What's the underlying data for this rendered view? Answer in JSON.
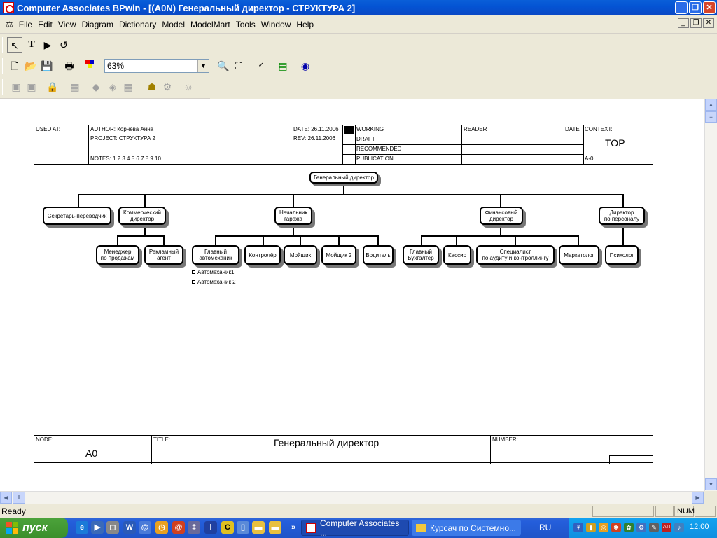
{
  "window": {
    "title": "Computer Associates BPwin - [(A0N) Генеральный директор - СТРУКТУРА 2]",
    "min_label": "_",
    "max_label": "❐",
    "close_label": "✕"
  },
  "menu": {
    "items": [
      "File",
      "Edit",
      "View",
      "Diagram",
      "Dictionary",
      "Model",
      "ModelMart",
      "Tools",
      "Window",
      "Help"
    ]
  },
  "toolbar": {
    "zoom_value": "63%"
  },
  "diagram": {
    "header": {
      "used_at": "USED AT:",
      "author": "AUTHOR:  Корнева Анна",
      "project": "PROJECT:  СТРУКТУРА 2",
      "date": "DATE:  26.11.2006",
      "rev": "REV:   26.11.2006",
      "notes": "NOTES:  1  2  3  4  5  6  7  8  9  10",
      "status": [
        "WORKING",
        "DRAFT",
        "RECOMMENDED",
        "PUBLICATION"
      ],
      "reader": "READER",
      "reader_date": "DATE",
      "context": "CONTEXT:",
      "context_value": "TOP",
      "context_node": "A-0"
    },
    "footer": {
      "node_label": "NODE:",
      "node_value": "A0",
      "title_label": "TITLE:",
      "title_value": "Генеральный директор",
      "number_label": "NUMBER:"
    },
    "boxes": {
      "gen_dir": "Генеральный директор",
      "secretary": "Секретарь-переводчик",
      "commercial": "Коммерческий\nдиректор",
      "garage": "Начальник\nгаража",
      "financial": "Финансовый\nдиректор",
      "hr": "Директор\nпо персоналу",
      "sales_mgr": "Менеджер\nпо продажам",
      "ad_agent": "Рекламный\nагент",
      "chief_mech": "Главный\nавтомеханик",
      "controller": "Контролёр",
      "washer": "Мойщик",
      "washer2": "Мойщик 2",
      "driver": "Водитель",
      "chief_acc": "Главный\nБухгалтер",
      "cashier": "Кассир",
      "auditor": "Специалист\nпо аудиту и контроллингу",
      "marketer": "Маркетолог",
      "psychologist": "Психолог"
    },
    "sub_items": [
      "Автомеханик1",
      "Автомеханик 2"
    ]
  },
  "statusbar": {
    "text": "Ready",
    "num": "NUM"
  },
  "taskbar": {
    "start": "пуск",
    "tasks": [
      "Computer Associates ...",
      "Курсач по Системно..."
    ],
    "lang": "RU",
    "clock": "12:00"
  }
}
